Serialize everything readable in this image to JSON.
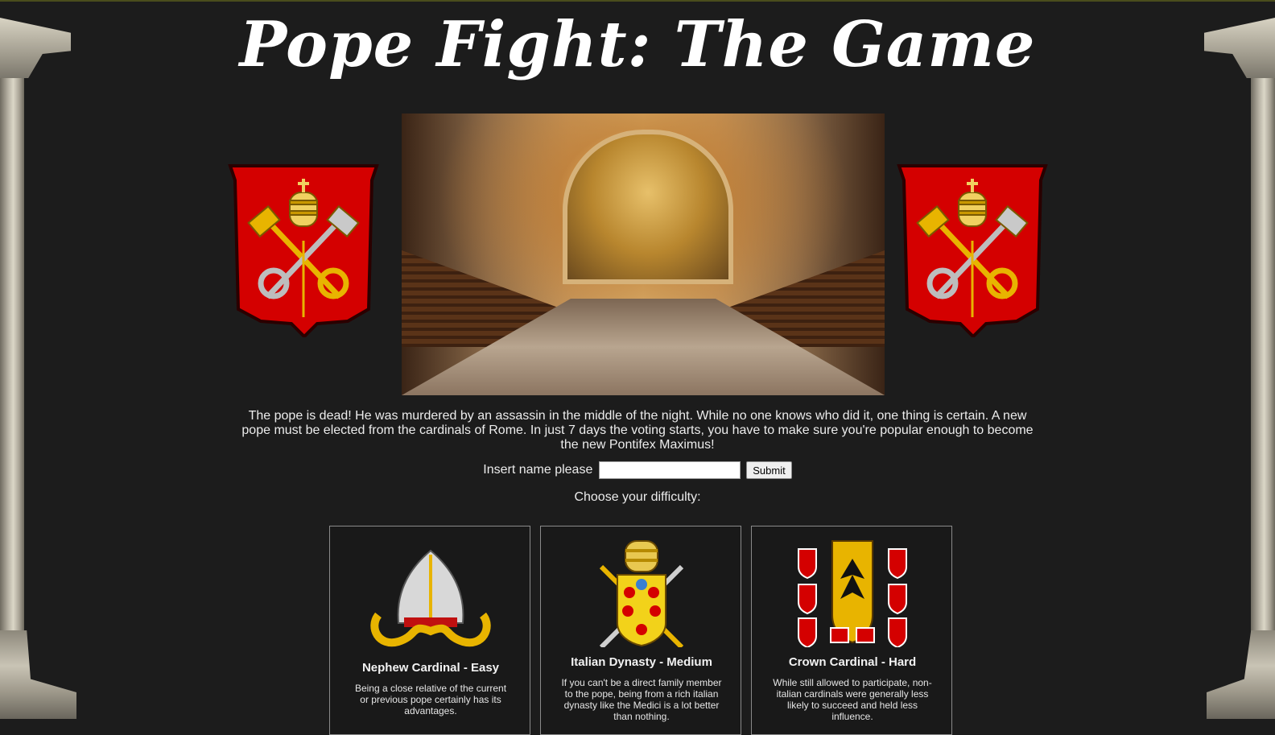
{
  "game": {
    "title": "Pope Fight: The Game",
    "intro": "The pope is dead! He was murdered by an assassin in the middle of the night. While no one knows who did it, one thing is certain. A new pope must be elected from the cardinals of Rome. In just 7 days the voting starts, you have to make sure you're popular enough to become the new Pontifex Maximus!",
    "name_label": "Insert name please",
    "name_value": "",
    "submit_label": "Submit",
    "choose_label": "Choose your difficulty:"
  },
  "difficulties": [
    {
      "title": "Nephew Cardinal - Easy",
      "description": "Being a close relative of the current or previous pope certainly has its advantages.",
      "icon": "mitre-icon"
    },
    {
      "title": "Italian Dynasty - Medium",
      "description": "If you can't be a direct family member to the pope, being from a rich italian dynasty like the Medici is a lot better than nothing.",
      "icon": "medici-crest-icon"
    },
    {
      "title": "Crown Cardinal - Hard",
      "description": "While still allowed to participate, non-italian cardinals were generally less likely to succeed and held less influence.",
      "icon": "imperial-crests-icon"
    }
  ],
  "colors": {
    "background": "#1c1c1c",
    "shield_red": "#d40000",
    "gold": "#e8b400"
  }
}
